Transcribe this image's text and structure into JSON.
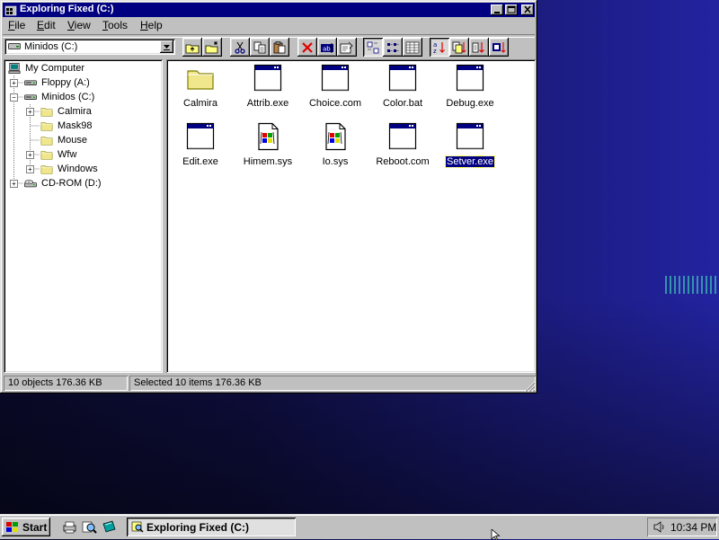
{
  "window": {
    "title": "Exploring Fixed (C:)",
    "menu": [
      "File",
      "Edit",
      "View",
      "Tools",
      "Help"
    ],
    "menu_underline": [
      "F",
      "E",
      "V",
      "T",
      "H"
    ]
  },
  "toolbar": {
    "drive_selected": "Minidos (C:)",
    "buttons": [
      "up-folder",
      "map-network-drive",
      "cut",
      "copy",
      "paste",
      "delete",
      "rename",
      "properties",
      "large-icons",
      "small-icons",
      "list",
      "details",
      "sort-name",
      "sort-type",
      "sort-size",
      "sort-date"
    ]
  },
  "tree": [
    {
      "label": "My Computer",
      "icon": "computer-icon"
    },
    {
      "label": "Floppy (A:)",
      "icon": "floppy-drive-icon"
    },
    {
      "label": "Minidos (C:)",
      "icon": "hard-drive-icon"
    },
    {
      "label": "Calmira",
      "icon": "folder-icon"
    },
    {
      "label": "Mask98",
      "icon": "folder-icon"
    },
    {
      "label": "Mouse",
      "icon": "folder-icon"
    },
    {
      "label": "Wfw",
      "icon": "folder-icon"
    },
    {
      "label": "Windows",
      "icon": "folder-icon"
    },
    {
      "label": "CD-ROM (D:)",
      "icon": "cdrom-drive-icon"
    }
  ],
  "files": [
    {
      "label": "Calmira",
      "icon": "folder-icon"
    },
    {
      "label": "Attrib.exe",
      "icon": "program-window-icon"
    },
    {
      "label": "Choice.com",
      "icon": "program-window-icon"
    },
    {
      "label": "Color.bat",
      "icon": "program-window-icon"
    },
    {
      "label": "Debug.exe",
      "icon": "program-window-icon"
    },
    {
      "label": "Edit.exe",
      "icon": "program-window-icon"
    },
    {
      "label": "Himem.sys",
      "icon": "system-file-icon"
    },
    {
      "label": "Io.sys",
      "icon": "system-file-icon"
    },
    {
      "label": "Reboot.com",
      "icon": "program-window-icon"
    },
    {
      "label": "Setver.exe",
      "icon": "program-window-icon",
      "selected": true
    }
  ],
  "status": {
    "objects": "10 objects   176.36 KB",
    "selected": "Selected 10 items   176.36 KB"
  },
  "taskbar": {
    "start_label": "Start",
    "task_label": "Exploring Fixed (C:)",
    "clock": "10:34 PM"
  },
  "colors": {
    "titlebar": "#000080",
    "face": "#c0c0c0",
    "selection": "#000080",
    "folder": "#f0e68c"
  }
}
